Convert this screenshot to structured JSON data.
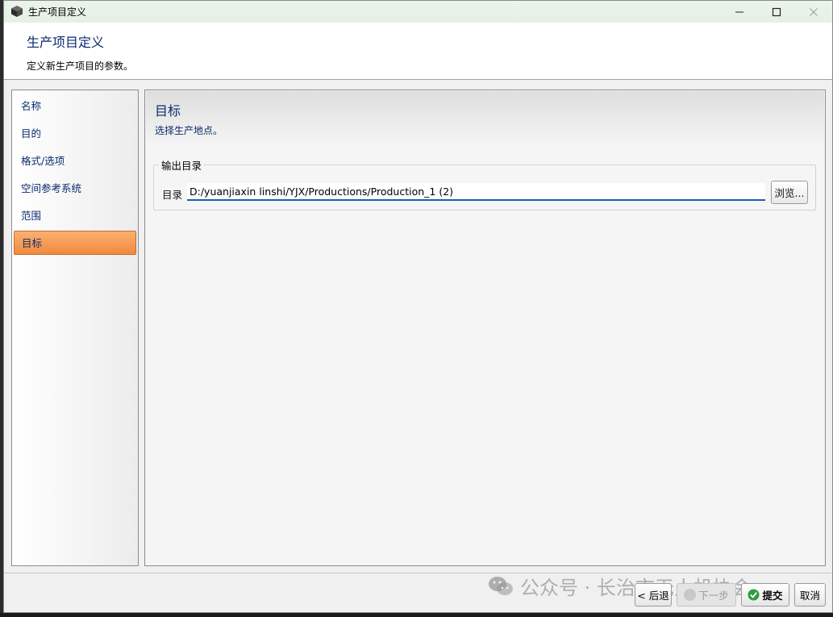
{
  "window": {
    "title": "生产项目定义",
    "header_title": "生产项目定义",
    "header_subtitle": "定义新生产项目的参数。"
  },
  "sidebar": {
    "items": [
      {
        "label": "名称",
        "active": false
      },
      {
        "label": "目的",
        "active": false
      },
      {
        "label": "格式/选项",
        "active": false
      },
      {
        "label": "空间参考系统",
        "active": false
      },
      {
        "label": "范围",
        "active": false
      },
      {
        "label": "目标",
        "active": true
      }
    ]
  },
  "content": {
    "title": "目标",
    "subtitle": "选择生产地点。",
    "group_label": "输出目录",
    "directory_label": "目录",
    "directory_value": "D:/yuanjiaxin linshi/YJX/Productions/Production_1 (2)",
    "browse_label": "浏览..."
  },
  "footer": {
    "back_label": "< 后退",
    "next_label": "下一步",
    "submit_label": "提交",
    "cancel_label": "取消",
    "watermark": "公众号 · 长治市无人机协会"
  },
  "colors": {
    "accent_orange": "#f08a3e",
    "title_blue": "#0a2a6e",
    "input_underline": "#1a5fb4"
  }
}
